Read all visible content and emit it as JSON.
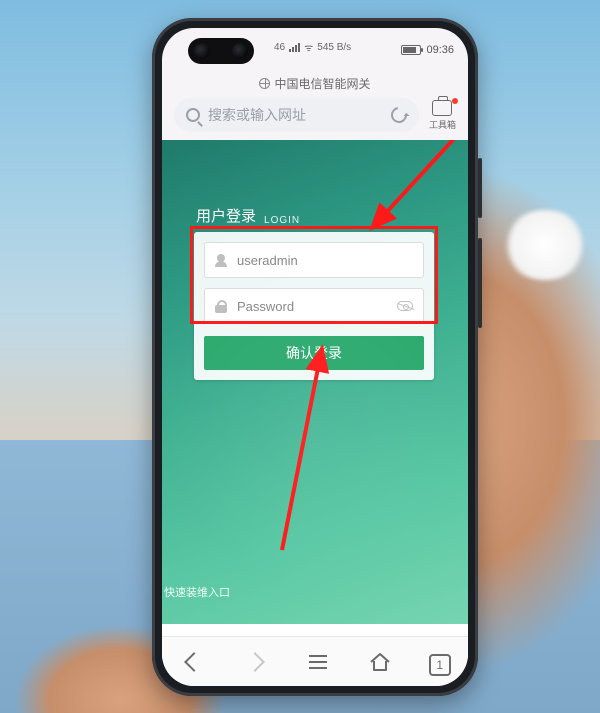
{
  "statusbar": {
    "network_label": "545 B/s",
    "net_gen": "46",
    "time": "09:36"
  },
  "browser": {
    "page_title": "中国电信智能网关",
    "url_placeholder": "搜索或输入网址",
    "toolbox_label": "工具箱",
    "tab_count": "1"
  },
  "login": {
    "heading_cn": "用户登录",
    "heading_en": "LOGIN",
    "username_value": "useradmin",
    "password_placeholder": "Password",
    "submit_label": "确认登录"
  },
  "page": {
    "quick_link": "快速装维入口"
  }
}
